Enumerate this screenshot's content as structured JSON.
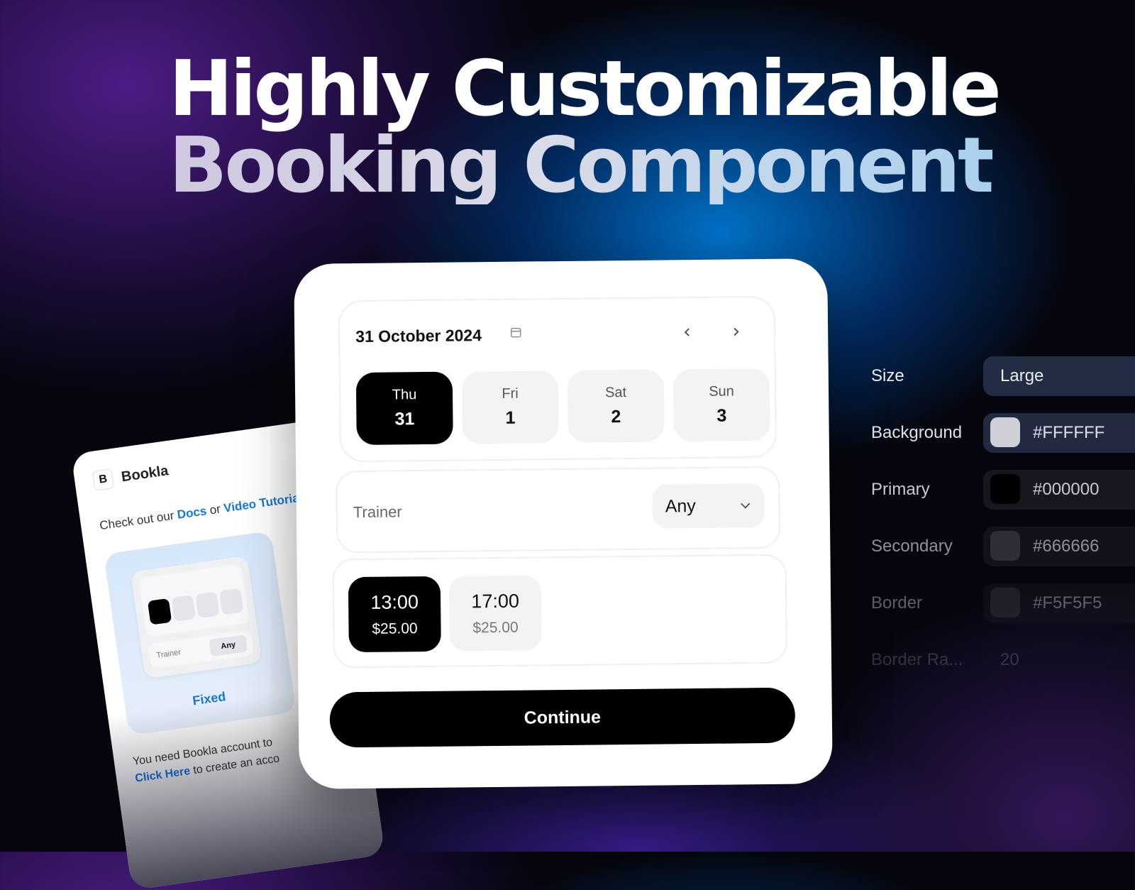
{
  "headline": {
    "line1": "Highly Customizable",
    "line2": "Booking Component"
  },
  "side_card": {
    "brand_letter": "B",
    "brand_name": "Bookla",
    "intro_prefix": "Check out our ",
    "docs_link": "Docs",
    "intro_or": " or ",
    "video_link": "Video Tutoria",
    "mini_trainer_label": "Trainer",
    "mini_trainer_value": "Any",
    "fixed_label": "Fixed",
    "footer_line1": "You need Bookla account to",
    "footer_link": "Click Here",
    "footer_line2_rest": " to create an acco"
  },
  "booking": {
    "date_title": "31 October 2024",
    "days": [
      {
        "weekday": "Thu",
        "day": "31",
        "selected": true
      },
      {
        "weekday": "Fri",
        "day": "1",
        "selected": false
      },
      {
        "weekday": "Sat",
        "day": "2",
        "selected": false
      },
      {
        "weekday": "Sun",
        "day": "3",
        "selected": false
      }
    ],
    "trainer_label": "Trainer",
    "trainer_value": "Any",
    "slots": [
      {
        "time": "13:00",
        "price": "$25.00",
        "selected": true
      },
      {
        "time": "17:00",
        "price": "$25.00",
        "selected": false
      }
    ],
    "continue_label": "Continue"
  },
  "settings": {
    "rows": [
      {
        "label": "Size",
        "value": "Large"
      },
      {
        "label": "Background",
        "value": "#FFFFFF",
        "swatch": "#FFFFFF"
      },
      {
        "label": "Primary",
        "value": "#000000",
        "swatch": "#000000"
      },
      {
        "label": "Secondary",
        "value": "#666666",
        "swatch": "#666666"
      },
      {
        "label": "Border",
        "value": "#F5F5F5",
        "swatch": "#F5F5F5"
      },
      {
        "label": "Border Ra...",
        "value": "20"
      }
    ]
  },
  "colors": {
    "accent_link": "#1677D8",
    "primary": "#000000"
  }
}
